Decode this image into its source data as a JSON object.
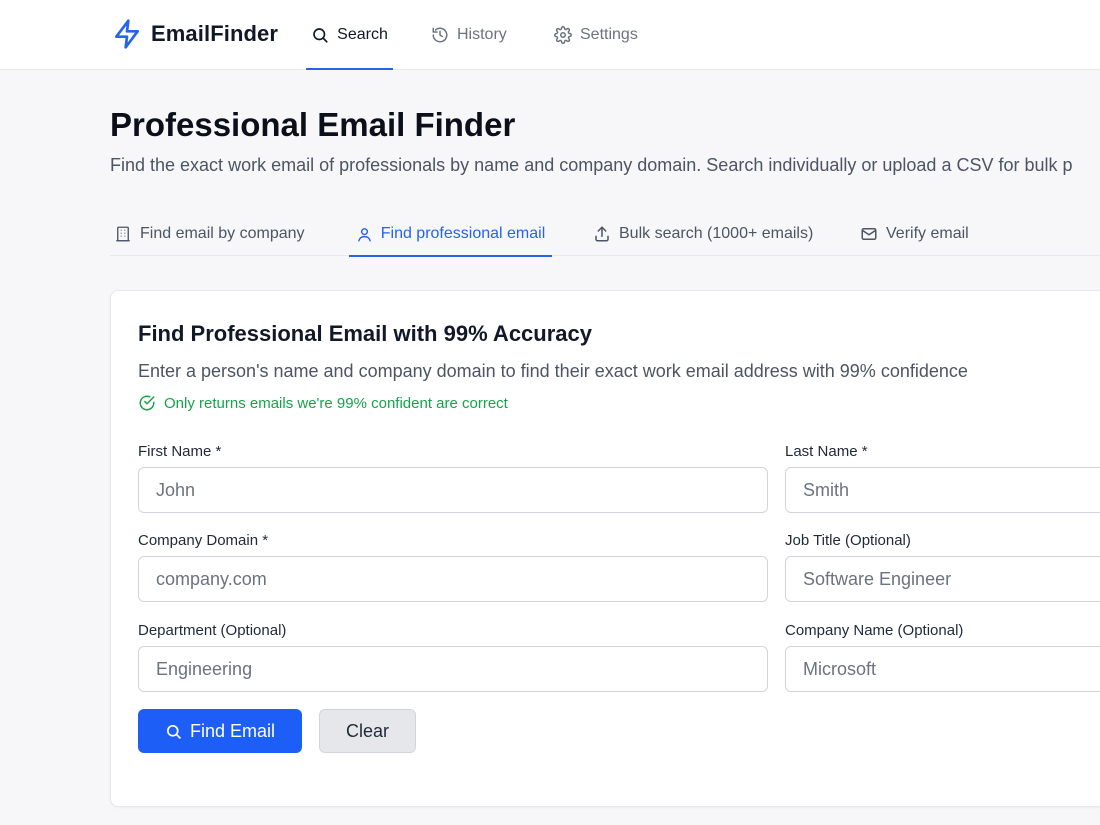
{
  "app": {
    "brand": "EmailFinder"
  },
  "nav": {
    "search": "Search",
    "history": "History",
    "settings": "Settings"
  },
  "page": {
    "title": "Professional Email Finder",
    "subtitle": "Find the exact work email of professionals by name and company domain. Search individually or upload a CSV for bulk p"
  },
  "tabs": {
    "company": "Find email by company",
    "professional": "Find professional email",
    "bulk": "Bulk search (1000+ emails)",
    "verify": "Verify email"
  },
  "card": {
    "title": "Find Professional Email with 99% Accuracy",
    "description": "Enter a person's name and company domain to find their exact work email address with 99% confidence",
    "confidence_note": "Only returns emails we're 99% confident are correct"
  },
  "form": {
    "first_name": {
      "label": "First Name *",
      "placeholder": "John",
      "value": ""
    },
    "last_name": {
      "label": "Last Name *",
      "placeholder": "Smith",
      "value": ""
    },
    "company_domain": {
      "label": "Company Domain *",
      "placeholder": "company.com",
      "value": ""
    },
    "job_title": {
      "label": "Job Title (Optional)",
      "placeholder": "Software Engineer",
      "value": ""
    },
    "department": {
      "label": "Department (Optional)",
      "placeholder": "Engineering",
      "value": ""
    },
    "company_name": {
      "label": "Company Name (Optional)",
      "placeholder": "Microsoft",
      "value": ""
    },
    "find_button": "Find Email",
    "clear_button": "Clear"
  },
  "colors": {
    "accent": "#2563eb",
    "primary_button": "#1d5ef6",
    "success": "#16a34a"
  }
}
